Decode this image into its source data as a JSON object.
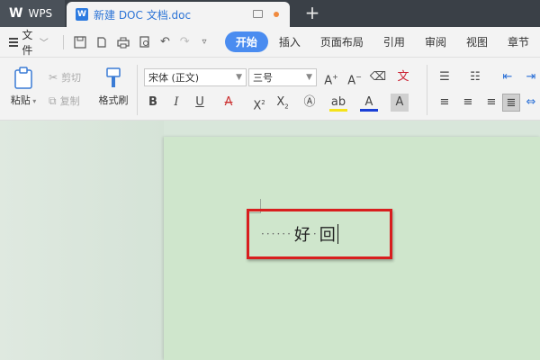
{
  "titlebar": {
    "app_name": "WPS",
    "doc_tab_title": "新建 DOC 文档.doc",
    "doc_icon_letter": "W",
    "new_tab_symbol": "+"
  },
  "menubar": {
    "file_label": "文件",
    "tabs": [
      "开始",
      "插入",
      "页面布局",
      "引用",
      "审阅",
      "视图",
      "章节"
    ],
    "active_tab": "开始"
  },
  "ribbon": {
    "paste_label": "粘贴",
    "cut_label": "剪切",
    "copy_label": "复制",
    "format_painter_label": "格式刷",
    "font_name": "宋体 (正文)",
    "font_size": "三号"
  },
  "document": {
    "leader_dots": "······",
    "char_1": "好",
    "mid_dot": "·",
    "char_2": "回"
  },
  "colors": {
    "accent": "#4a8cf0",
    "titlebar": "#3a4047",
    "highlight_border": "#d81e1e",
    "page_bg": "#cfe6cc"
  }
}
